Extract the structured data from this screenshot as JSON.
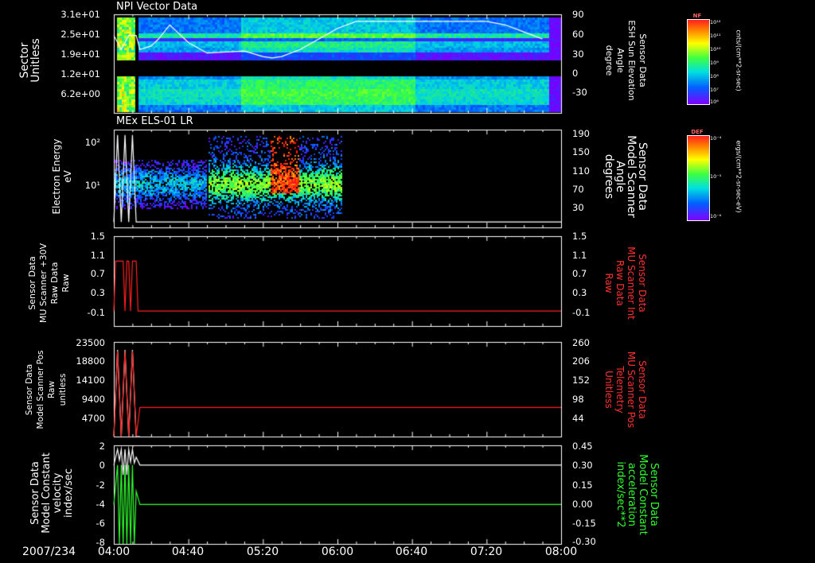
{
  "date_label": "2007/234",
  "x_ticks": [
    "04:00",
    "04:40",
    "05:20",
    "06:00",
    "06:40",
    "07:20",
    "08:00"
  ],
  "panels": {
    "p1": {
      "title": "NPI Vector Data",
      "left_label": [
        "Sector",
        "Unitless"
      ],
      "left_ticks": [
        "3.1e+01",
        "2.5e+01",
        "1.9e+01",
        "1.2e+01",
        "6.2e+00"
      ],
      "right_label": [
        "Sensor Data",
        "ESH Sun Elevation",
        "Angle",
        "degree"
      ],
      "right_ticks": [
        "90",
        "60",
        "30",
        "0",
        "-30"
      ],
      "colorbar": {
        "title": "NF",
        "unit": "cnts/(cm**2-sr-sec)",
        "ticks": [
          "10¹²",
          "10¹¹",
          "10¹⁰",
          "10⁹",
          "10⁸",
          "10⁷",
          "10⁶"
        ]
      }
    },
    "p2": {
      "title": "MEx ELS-01 LR",
      "left_label": [
        "Electron Energy",
        "eV"
      ],
      "left_ticks": [
        "10²",
        "10¹"
      ],
      "right_label": [
        "Sensor Data",
        "Model Scanner",
        "Angle",
        "degrees"
      ],
      "right_ticks": [
        "190",
        "150",
        "110",
        "70",
        "30"
      ],
      "colorbar": {
        "title": "DEF",
        "unit": "ergs/(cm**2-sr-sec-eV)",
        "ticks": [
          "10⁻⁴",
          "10⁻⁵",
          "10⁻⁶"
        ]
      }
    },
    "p3": {
      "left_label": [
        "Sensor Data",
        "MU Scanner +30V",
        "Raw Data",
        "Raw"
      ],
      "left_ticks": [
        "1.5",
        "1.1",
        "0.7",
        "0.3",
        "-0.1"
      ],
      "right_label": [
        "Sensor Data",
        "MU Scanner Int",
        "Raw Data",
        "Raw"
      ],
      "right_ticks": [
        "1.5",
        "1.1",
        "0.7",
        "0.3",
        "-0.1"
      ]
    },
    "p4": {
      "left_label": [
        "Sensor Data",
        "Model Scanner Pos",
        "Raw",
        "unitless"
      ],
      "left_ticks": [
        "23500",
        "18800",
        "14100",
        "9400",
        "4700"
      ],
      "right_label": [
        "Sensor Data",
        "MU Scanner Pos",
        "Telemetry",
        "Unitless"
      ],
      "right_ticks": [
        "260",
        "206",
        "152",
        "98",
        "44"
      ]
    },
    "p5": {
      "left_label": [
        "Sensor Data",
        "Model Constant",
        "velocity",
        "index/sec"
      ],
      "left_ticks": [
        "2",
        "0",
        "-2",
        "-4",
        "-6",
        "-8"
      ],
      "right_label": [
        "Sensor Data",
        "Model Constant",
        "acceleration",
        "index/sec**2"
      ],
      "right_ticks": [
        "0.45",
        "0.30",
        "0.15",
        "0.00",
        "-0.15",
        "-0.30"
      ]
    }
  },
  "chart_data": [
    {
      "type": "heatmap",
      "title": "NPI Vector Data",
      "ylabel": "Sector Unitless",
      "y_ticks": [
        31,
        25,
        19,
        12,
        6.2
      ],
      "y2label": "Sensor Data ESH Sun Elevation Angle degree",
      "y2lim": [
        -50,
        90
      ],
      "overlay_line": {
        "x": [
          "04:00",
          "04:04",
          "04:08",
          "04:12",
          "04:14",
          "04:20",
          "04:24",
          "04:30",
          "04:40",
          "04:50",
          "05:10",
          "05:20",
          "05:25",
          "05:30",
          "05:40",
          "05:50",
          "06:00",
          "06:10",
          "06:20",
          "06:30",
          "07:00",
          "07:20",
          "07:30",
          "07:40",
          "07:50"
        ],
        "y": [
          60,
          40,
          60,
          60,
          40,
          45,
          55,
          75,
          50,
          35,
          38,
          30,
          28,
          30,
          40,
          55,
          70,
          80,
          80,
          80,
          80,
          80,
          75,
          65,
          55
        ]
      },
      "colorbar": {
        "label": "NF",
        "unit": "cnts/(cm**2-sr-sec)",
        "range": [
          "1e6",
          "1e12"
        ]
      }
    },
    {
      "type": "heatmap",
      "title": "MEx ELS-01 LR",
      "ylabel": "Electron Energy eV",
      "y_scale": "log",
      "y2label": "Sensor Data Model Scanner Angle degrees",
      "y2lim": [
        10,
        190
      ],
      "overlay_line": {
        "x": [
          "04:00",
          "04:02",
          "04:04",
          "04:06",
          "04:08",
          "04:10",
          "04:12",
          "04:14",
          "08:00"
        ],
        "y": [
          20,
          180,
          20,
          180,
          20,
          180,
          20,
          20,
          20
        ]
      },
      "colorbar": {
        "label": "DEF",
        "unit": "ergs/(cm**2-sr-sec-eV)",
        "range": [
          "1e-6",
          "1e-4"
        ]
      }
    },
    {
      "type": "line",
      "ylabel": "Sensor Data MU Scanner +30V Raw Data Raw",
      "ylim": [
        -0.3,
        1.5
      ],
      "y2label": "Sensor Data MU Scanner Int Raw Data Raw",
      "series": [
        {
          "name": "Sensor Data MU Scanner Int Raw Data Raw",
          "color": "#ff2020",
          "x": [
            "04:00",
            "04:01",
            "04:02",
            "04:05",
            "04:06",
            "04:07",
            "04:08",
            "04:09",
            "04:10",
            "04:11",
            "04:12",
            "04:13",
            "04:14",
            "08:00"
          ],
          "y": [
            0.0,
            1.0,
            1.0,
            1.0,
            0.0,
            1.0,
            1.0,
            0.0,
            1.0,
            1.0,
            1.0,
            0.0,
            0.0,
            0.0
          ]
        }
      ]
    },
    {
      "type": "line",
      "ylabel": "Sensor Data Model Scanner Pos Raw unitless",
      "ylim": [
        0,
        23500
      ],
      "y2label": "Sensor Data MU Scanner Pos Telemetry Unitless",
      "y2lim": [
        0,
        260
      ],
      "series": [
        {
          "name": "Sensor Data Model Scanner Pos Raw unitless",
          "color": "#ffffff",
          "x": [
            "04:00",
            "04:02",
            "04:04",
            "04:06",
            "04:08",
            "04:10",
            "04:12",
            "04:14"
          ],
          "y": [
            0,
            21500,
            0,
            21500,
            0,
            21500,
            0,
            0
          ]
        },
        {
          "name": "Sensor Data MU Scanner Pos Telemetry Unitless",
          "color": "#ff2020",
          "x": [
            "04:00",
            "04:02",
            "04:04",
            "04:06",
            "04:08",
            "04:10",
            "04:12",
            "04:14",
            "08:00"
          ],
          "y": [
            0,
            235,
            0,
            235,
            0,
            235,
            0,
            80,
            80
          ]
        }
      ]
    },
    {
      "type": "line",
      "ylabel": "Sensor Data Model Constant velocity index/sec",
      "ylim": [
        -8,
        2
      ],
      "y2label": "Sensor Data Model Constant acceleration index/sec**2",
      "y2lim": [
        -0.3,
        0.45
      ],
      "series": [
        {
          "name": "Sensor Data Model Constant velocity index/sec",
          "color": "#ffffff",
          "x": [
            "04:00",
            "04:02",
            "04:03",
            "04:04",
            "04:05",
            "04:06",
            "04:07",
            "04:08",
            "04:09",
            "04:10",
            "04:11",
            "04:12",
            "04:14",
            "08:00"
          ],
          "y": [
            0,
            1.6,
            0.5,
            1.6,
            -1,
            1.6,
            -1,
            1.6,
            0.3,
            1.6,
            0.2,
            0.8,
            0,
            0
          ]
        },
        {
          "name": "Sensor Data Model Constant acceleration index/sec**2",
          "color": "#30ff30",
          "x": [
            "04:00",
            "04:02",
            "04:03",
            "04:04",
            "04:05",
            "04:06",
            "04:07",
            "04:08",
            "04:09",
            "04:10",
            "04:11",
            "04:12",
            "04:14",
            "08:00"
          ],
          "y": [
            0,
            0.3,
            -0.3,
            0.3,
            -0.3,
            0.3,
            -0.3,
            0.3,
            -0.3,
            0.3,
            -0.3,
            0.1,
            0,
            0
          ]
        }
      ]
    }
  ]
}
